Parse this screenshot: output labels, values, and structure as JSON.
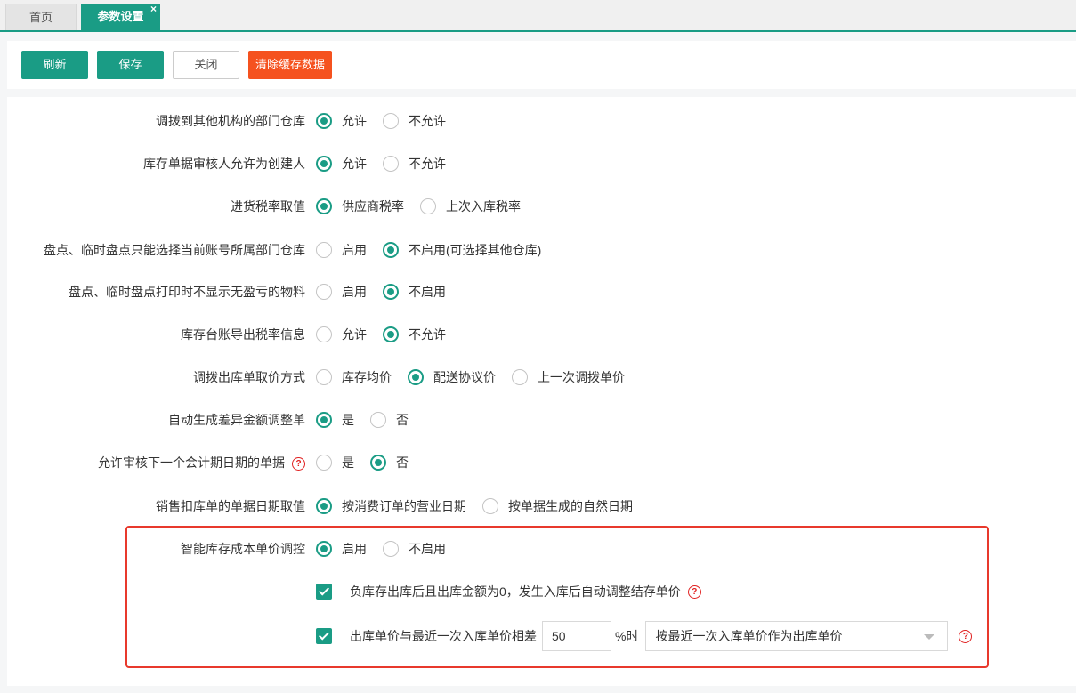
{
  "tabs": [
    {
      "label": "首页",
      "active": false
    },
    {
      "label": "参数设置",
      "active": true,
      "close_glyph": "×"
    }
  ],
  "toolbar": {
    "refresh_label": "刷新",
    "save_label": "保存",
    "close_label": "关闭",
    "clear_cache_label": "清除缓存数据"
  },
  "settings": [
    {
      "label": "调拨到其他机构的部门仓库",
      "options": [
        "允许",
        "不允许"
      ],
      "selected": 0
    },
    {
      "label": "库存单据审核人允许为创建人",
      "options": [
        "允许",
        "不允许"
      ],
      "selected": 0
    },
    {
      "label": "进货税率取值",
      "options": [
        "供应商税率",
        "上次入库税率"
      ],
      "selected": 0
    },
    {
      "label": "盘点、临时盘点只能选择当前账号所属部门仓库",
      "options": [
        "启用",
        "不启用(可选择其他仓库)"
      ],
      "selected": 1
    },
    {
      "label": "盘点、临时盘点打印时不显示无盈亏的物料",
      "options": [
        "启用",
        "不启用"
      ],
      "selected": 1
    },
    {
      "label": "库存台账导出税率信息",
      "options": [
        "允许",
        "不允许"
      ],
      "selected": 1
    },
    {
      "label": "调拨出库单取价方式",
      "options": [
        "库存均价",
        "配送协议价",
        "上一次调拨单价"
      ],
      "selected": 1
    },
    {
      "label": "自动生成差异金额调整单",
      "options": [
        "是",
        "否"
      ],
      "selected": 0
    },
    {
      "label": "允许审核下一个会计期日期的单据",
      "options": [
        "是",
        "否"
      ],
      "selected": 1,
      "help": true
    },
    {
      "label": "销售扣库单的单据日期取值",
      "options": [
        "按消费订单的营业日期",
        "按单据生成的自然日期"
      ],
      "selected": 0
    },
    {
      "label": "智能库存成本单价调控",
      "options": [
        "启用",
        "不启用"
      ],
      "selected": 0
    }
  ],
  "smart_cost": {
    "checkbox1_label": "负库存出库后且出库金额为0，发生入库后自动调整结存单价",
    "checkbox1_checked": true,
    "checkbox2_label_prefix": "出库单价与最近一次入库单价相差",
    "threshold_value": "50",
    "checkbox2_label_suffix": "%时",
    "checkbox2_checked": true,
    "strategy_selected": "按最近一次入库单价作为出库单价"
  },
  "colors": {
    "primary": "#1a9c85",
    "danger_button": "#f5521f",
    "highlight_border": "#e8392c",
    "help_icon": "#e02020"
  },
  "icons": {
    "help": "?",
    "dropdown": "caret-down"
  }
}
